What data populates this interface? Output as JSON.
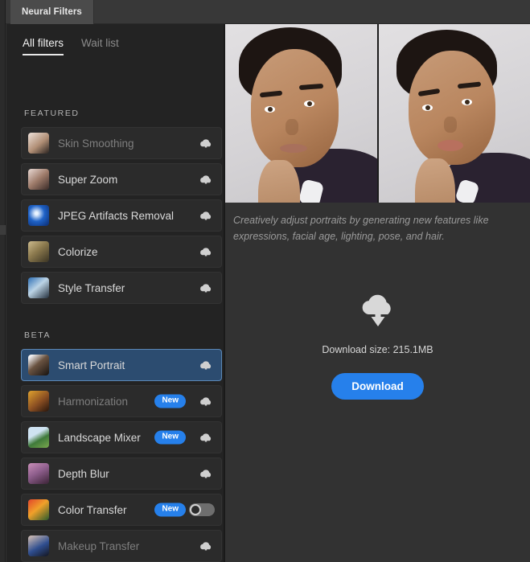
{
  "window": {
    "tab_label": "Neural Filters"
  },
  "subtabs": [
    {
      "label": "All filters",
      "active": true
    },
    {
      "label": "Wait list",
      "active": false
    }
  ],
  "sections": [
    {
      "title": "FEATURED",
      "items": [
        {
          "label": "Skin Smoothing",
          "state": "dim",
          "badge": null,
          "action": "cloud-download-icon"
        },
        {
          "label": "Super Zoom",
          "state": "normal",
          "badge": null,
          "action": "cloud-download-icon"
        },
        {
          "label": "JPEG Artifacts Removal",
          "state": "normal",
          "badge": null,
          "action": "cloud-download-icon"
        },
        {
          "label": "Colorize",
          "state": "normal",
          "badge": null,
          "action": "cloud-download-icon"
        },
        {
          "label": "Style Transfer",
          "state": "normal",
          "badge": null,
          "action": "cloud-download-icon"
        }
      ]
    },
    {
      "title": "BETA",
      "items": [
        {
          "label": "Smart Portrait",
          "state": "selected",
          "badge": null,
          "action": "cloud-download-icon"
        },
        {
          "label": "Harmonization",
          "state": "dim",
          "badge": "New",
          "action": "cloud-download-icon"
        },
        {
          "label": "Landscape Mixer",
          "state": "normal",
          "badge": "New",
          "action": "cloud-download-icon"
        },
        {
          "label": "Depth Blur",
          "state": "normal",
          "badge": null,
          "action": "cloud-download-icon"
        },
        {
          "label": "Color Transfer",
          "state": "normal",
          "badge": "New",
          "action": "toggle-off"
        },
        {
          "label": "Makeup Transfer",
          "state": "dim",
          "badge": null,
          "action": "cloud-download-icon"
        }
      ]
    }
  ],
  "detail": {
    "description": "Creatively adjust portraits by generating new features like expressions, facial age, lighting, pose, and hair.",
    "download_size": "Download size: 215.1MB",
    "download_button": "Download",
    "preview_alt_left": "portrait-before",
    "preview_alt_right": "portrait-after"
  },
  "colors": {
    "accent_blue": "#2680eb",
    "selected_row": "#2c4c70",
    "selected_border": "#5b87b5",
    "panel_bg": "#232323",
    "detail_bg": "#323232",
    "row_bg": "#2b2b2b",
    "text_primary": "#d9d9d9",
    "text_dim": "#7e7e7e"
  }
}
